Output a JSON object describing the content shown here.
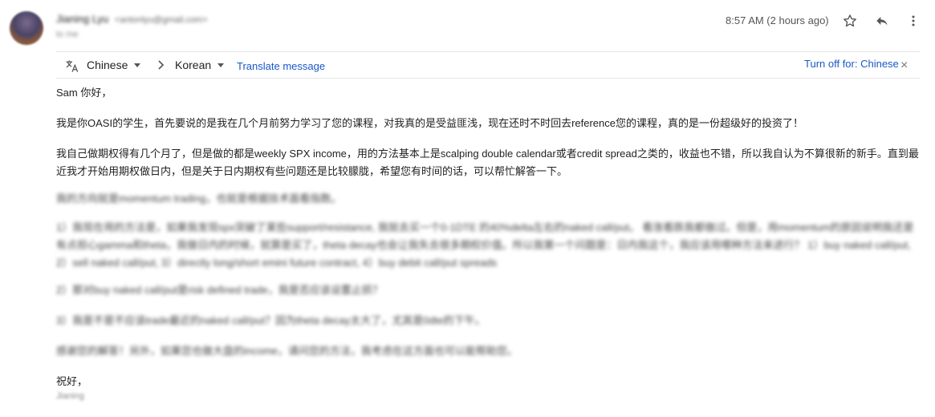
{
  "sender": {
    "name": "Jianing Lyu",
    "email": "<antonlyu@gmail.com>",
    "recipient": "to me"
  },
  "header": {
    "timestamp": "8:57 AM (2 hours ago)",
    "icons": [
      "star-icon",
      "reply-icon",
      "more-vert-icon"
    ]
  },
  "translate_bar": {
    "source_language": "Chinese",
    "target_language": "Korean",
    "translate_link": "Translate message",
    "turn_off": "Turn off for: Chinese",
    "close": "×"
  },
  "body": {
    "greeting": "Sam 你好，",
    "para1": "我是你OASI的学生，首先要说的是我在几个月前努力学习了您的课程，对我真的是受益匪浅，现在还时不时回去reference您的课程，真的是一份超级好的投资了！",
    "para2": "我自己做期权得有几个月了，但是做的都是weekly SPX income，用的方法基本上是scalping double calendar或者credit spread之类的，收益也不错，所以我自认为不算很新的新手。直到最近我才开始用期权做日内，但是关于日内期权有些问题还是比较朦胧，希望您有时间的话，可以帮忙解答一下。",
    "blur1": "我的方向就是momentum trading，也就是根据技术面看指数。",
    "blur2": "1）我现在用的方法是，如果我发现spx突破了某些support/resistance, 我就去买一个0-1DTE 的40%delta左右的naked call/put。 看涨看跌我都做过。但是，用momentum的原因说明我还是有点担心gamma和theta，我做日内的时候，就算是买了，theta decay也会让我失去很多期权价值。所以我第一个问题是：日内我这个，我应该用哪种方法来进行？ 1）buy naked call/put, 2）sell naked call/put, 3）directly long/short emini future contract, 4）buy debit call/put spreads",
    "blur3": "2）那对buy naked call/put是risk defined trade，我是否应该设置止损？",
    "blur4": "3）我是不是不应该trade最近的naked call/put？因为theta decay太大了，尤其是0dte的下午。",
    "blur5": "感谢您的解答！另外，如果您也做大盘的income，请问您的方法，我考虑在这方面也可以能帮助您。",
    "signoff": "祝好，",
    "sig_name": "Jianing"
  }
}
